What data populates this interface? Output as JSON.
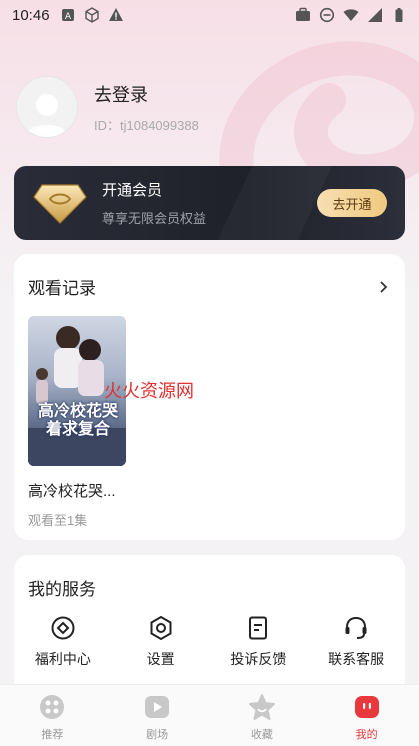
{
  "status_bar": {
    "time": "10:46",
    "left_icons": [
      "a-icon",
      "cube-icon",
      "warning-icon"
    ],
    "right_icons": [
      "briefcase-icon",
      "dnd-icon",
      "wifi-icon",
      "signal-icon",
      "battery-icon"
    ]
  },
  "profile": {
    "login_label": "去登录",
    "user_id": "ID：tj1084099388"
  },
  "vip": {
    "title": "开通会员",
    "subtitle": "尊享无限会员权益",
    "button_label": "去开通"
  },
  "history": {
    "title": "观看记录",
    "items": [
      {
        "name": "高冷校花哭...",
        "progress": "观看至1集",
        "poster_text": "高冷校花哭着求复合"
      }
    ],
    "watermark": "火火资源网"
  },
  "services": {
    "title": "我的服务",
    "items": [
      {
        "label": "福利中心",
        "icon": "gift-center-icon"
      },
      {
        "label": "设置",
        "icon": "settings-icon"
      },
      {
        "label": "投诉反馈",
        "icon": "feedback-icon"
      },
      {
        "label": "联系客服",
        "icon": "headset-icon"
      }
    ]
  },
  "bottom_nav": {
    "items": [
      {
        "label": "推荐",
        "icon": "recommend-icon",
        "active": false
      },
      {
        "label": "剧场",
        "icon": "theater-icon",
        "active": false
      },
      {
        "label": "收藏",
        "icon": "star-icon",
        "active": false
      },
      {
        "label": "我的",
        "icon": "mine-icon",
        "active": true
      }
    ]
  },
  "colors": {
    "accent": "#e8383d",
    "vip_gold": "#f0c97f",
    "vip_dark": "#1f2129"
  }
}
